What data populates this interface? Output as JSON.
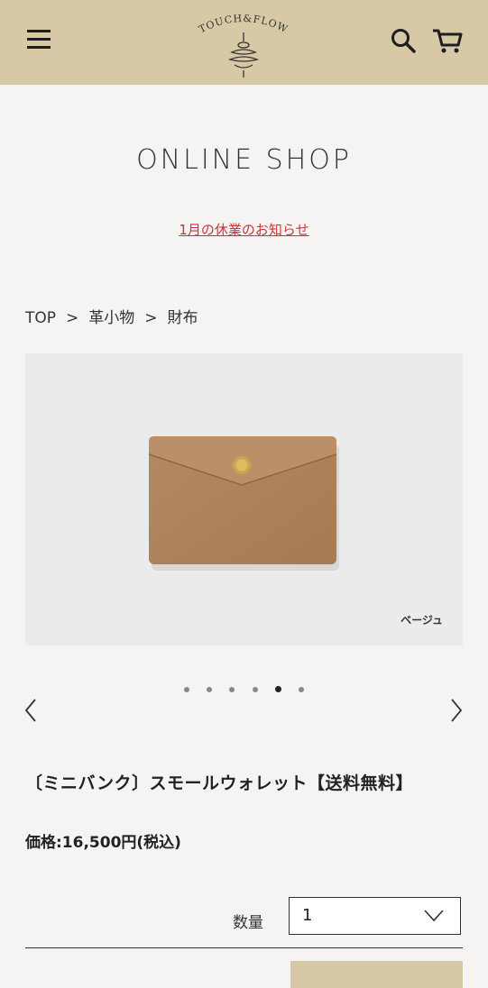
{
  "header": {
    "brand": "TOUCH&FLOW",
    "menu_icon": "hamburger-menu-icon",
    "search_icon": "search-icon",
    "cart_icon": "cart-icon",
    "background": "#d8c9a6"
  },
  "main": {
    "title": "ONLINE SHOP",
    "notice": "1月の休業のお知らせ",
    "notice_color": "#c8363a"
  },
  "breadcrumb": {
    "items": [
      "TOP",
      "革小物",
      "財布"
    ],
    "separator": ">"
  },
  "product": {
    "image_caption": "ベージュ",
    "carousel": {
      "total": 6,
      "active_index": 4,
      "prev_icon": "chevron-left-icon",
      "next_icon": "chevron-right-icon"
    },
    "name": "〔ミニバンク〕スモールウォレット【送料無料】",
    "price": "価格:16,500円(税込)"
  },
  "quantity": {
    "label": "数量",
    "value": "1",
    "chevron_icon": "chevron-down-icon"
  }
}
